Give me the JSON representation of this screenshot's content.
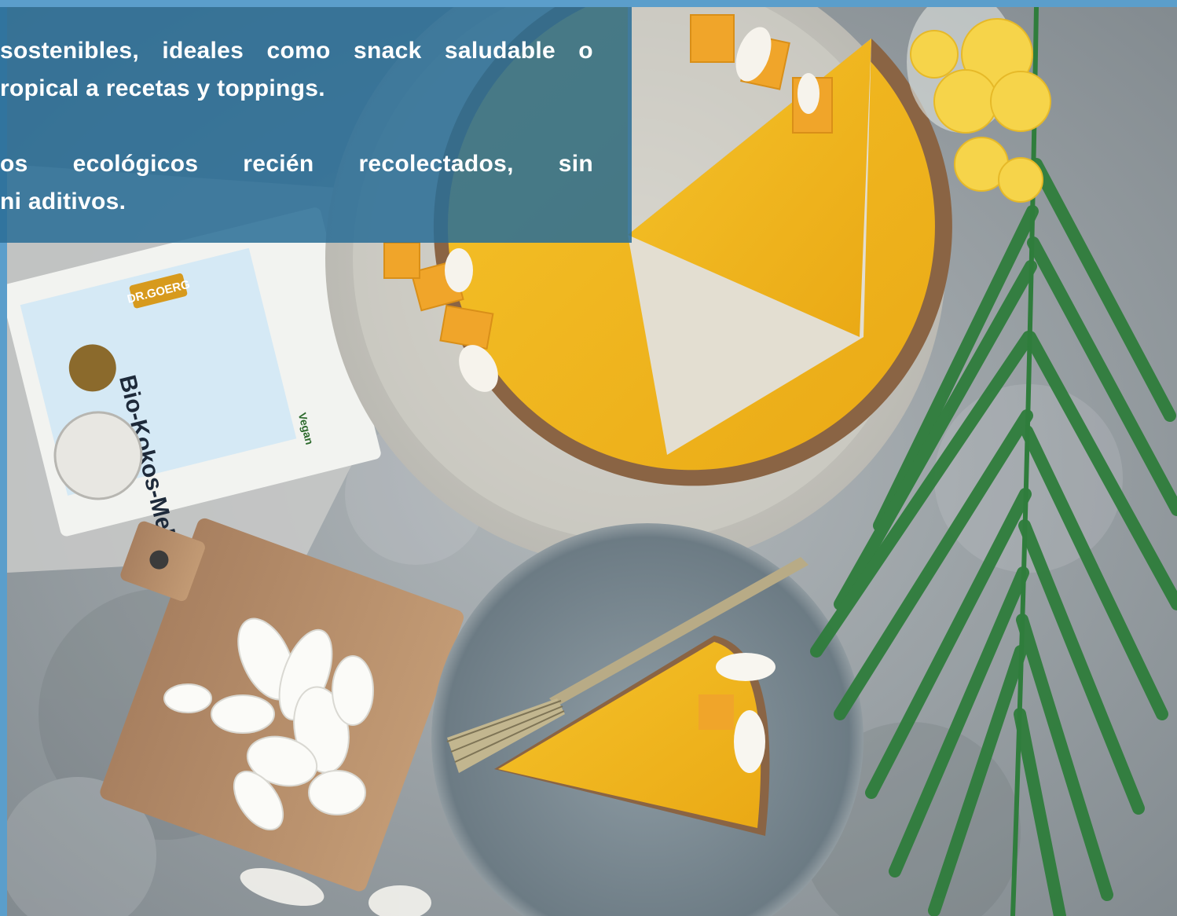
{
  "overlay": {
    "line1": [
      "sostenibles,",
      "ideales",
      "como",
      "snack",
      "saludable",
      "o"
    ],
    "line2": "ropical a recetas y toppings.",
    "line3": [
      "os",
      "ecológicos",
      "recién",
      "recolectados,",
      "sin"
    ],
    "line4": "ni aditivos."
  },
  "photo": {
    "package_brand": "DR.GOERG",
    "package_product": "Bio-Kokos-Mehl",
    "package_badge": "Vegan"
  },
  "colors": {
    "overlay": "#2a6e96",
    "frame": "#5b9ecb",
    "tart": "#f2b81e",
    "leaf": "#2f7d3c"
  }
}
